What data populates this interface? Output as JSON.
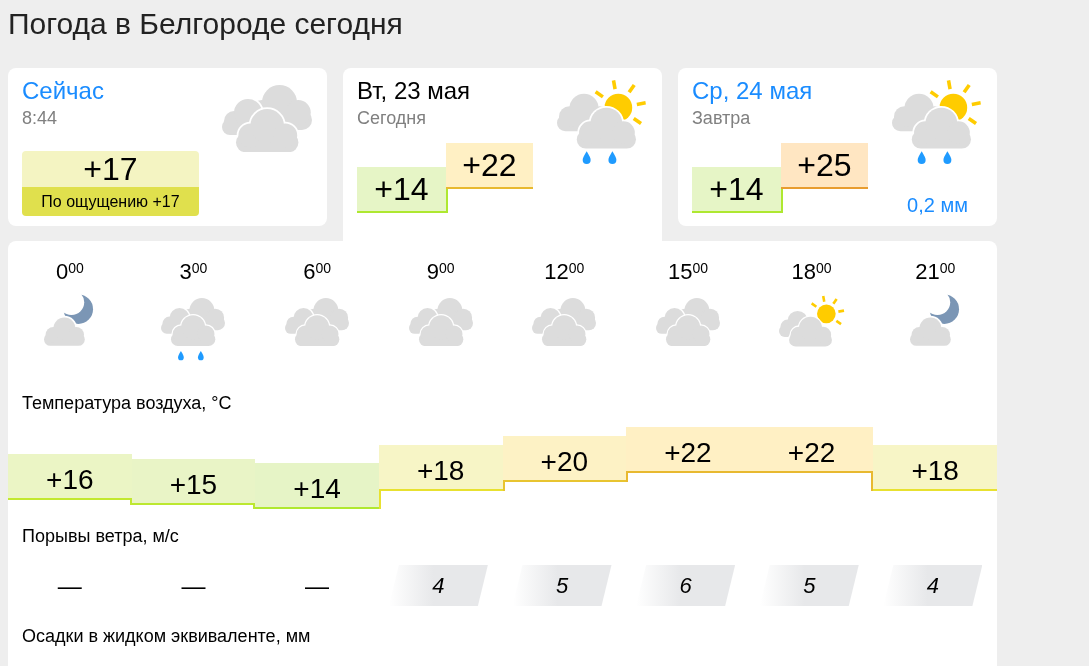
{
  "page_title": "Погода в Белгороде сегодня",
  "tabs": [
    {
      "kind": "now",
      "selected": false,
      "title": "Сейчас",
      "subtitle": "8:44",
      "icon": {
        "kind": "cloudy"
      },
      "temperature": {
        "value": "+17",
        "color": "#f4f4c2"
      },
      "feels_like": "По ощущению +17"
    },
    {
      "kind": "day",
      "selected": true,
      "title": "Вт, 23 мая",
      "subtitle": "Сегодня",
      "icon": {
        "kind": "showers"
      },
      "min": {
        "value": "+14",
        "color": "#e6f5c6"
      },
      "max": {
        "value": "+22",
        "color": "#fff0c4"
      }
    },
    {
      "kind": "day",
      "selected": false,
      "title": "Ср, 24 мая",
      "subtitle": "Завтра",
      "icon": {
        "kind": "showers"
      },
      "min": {
        "value": "+14",
        "color": "#e6f5c6"
      },
      "max": {
        "value": "+25",
        "color": "#ffe6c2"
      },
      "precipitation": "0,2 мм"
    }
  ],
  "forecast": {
    "hours": [
      {
        "time": "0$^{00}$",
        "icon": {
          "kind": "night"
        }
      },
      {
        "time": "3$^{00}$",
        "icon": {
          "kind": "rain"
        }
      },
      {
        "time": "6$^{00}$",
        "icon": {
          "kind": "cloudy"
        }
      },
      {
        "time": "9$^{00}$",
        "icon": {
          "kind": "cloudy"
        }
      },
      {
        "time": "12$^{00}$",
        "icon": {
          "kind": "cloudy"
        }
      },
      {
        "time": "15$^{00}$",
        "icon": {
          "kind": "cloudy"
        }
      },
      {
        "time": "18$^{00}$",
        "icon": {
          "kind": "partly"
        }
      },
      {
        "time": "21$^{00}$",
        "icon": {
          "kind": "night"
        }
      }
    ],
    "temperature": {
      "label": "Температура воздуха, °C",
      "values": [
        {
          "value": "+16",
          "color": "#ebf5c5"
        },
        {
          "value": "+15",
          "color": "#e9f4c6"
        },
        {
          "value": "+14",
          "color": "#e6f4c6"
        },
        {
          "value": "+18",
          "color": "#f7f5c6"
        },
        {
          "value": "+20",
          "color": "#fdf2c5"
        },
        {
          "value": "+22",
          "color": "#fff0c4"
        },
        {
          "value": "+22",
          "color": "#fff0c4"
        },
        {
          "value": "+18",
          "color": "#f7f5c6"
        }
      ]
    },
    "wind_gusts": {
      "label": "Порывы ветра, м/с",
      "values": [
        {
          "value": "—",
          "kind": "calm"
        },
        {
          "value": "—",
          "kind": "calm"
        },
        {
          "value": "—",
          "kind": "calm"
        },
        {
          "value": "4",
          "kind": "gust"
        },
        {
          "value": "5",
          "kind": "gust"
        },
        {
          "value": "6",
          "kind": "gust"
        },
        {
          "value": "5",
          "kind": "gust"
        },
        {
          "value": "4",
          "kind": "gust"
        }
      ]
    },
    "precipitation": {
      "label": "Осадки в жидком эквиваленте, мм"
    }
  }
}
